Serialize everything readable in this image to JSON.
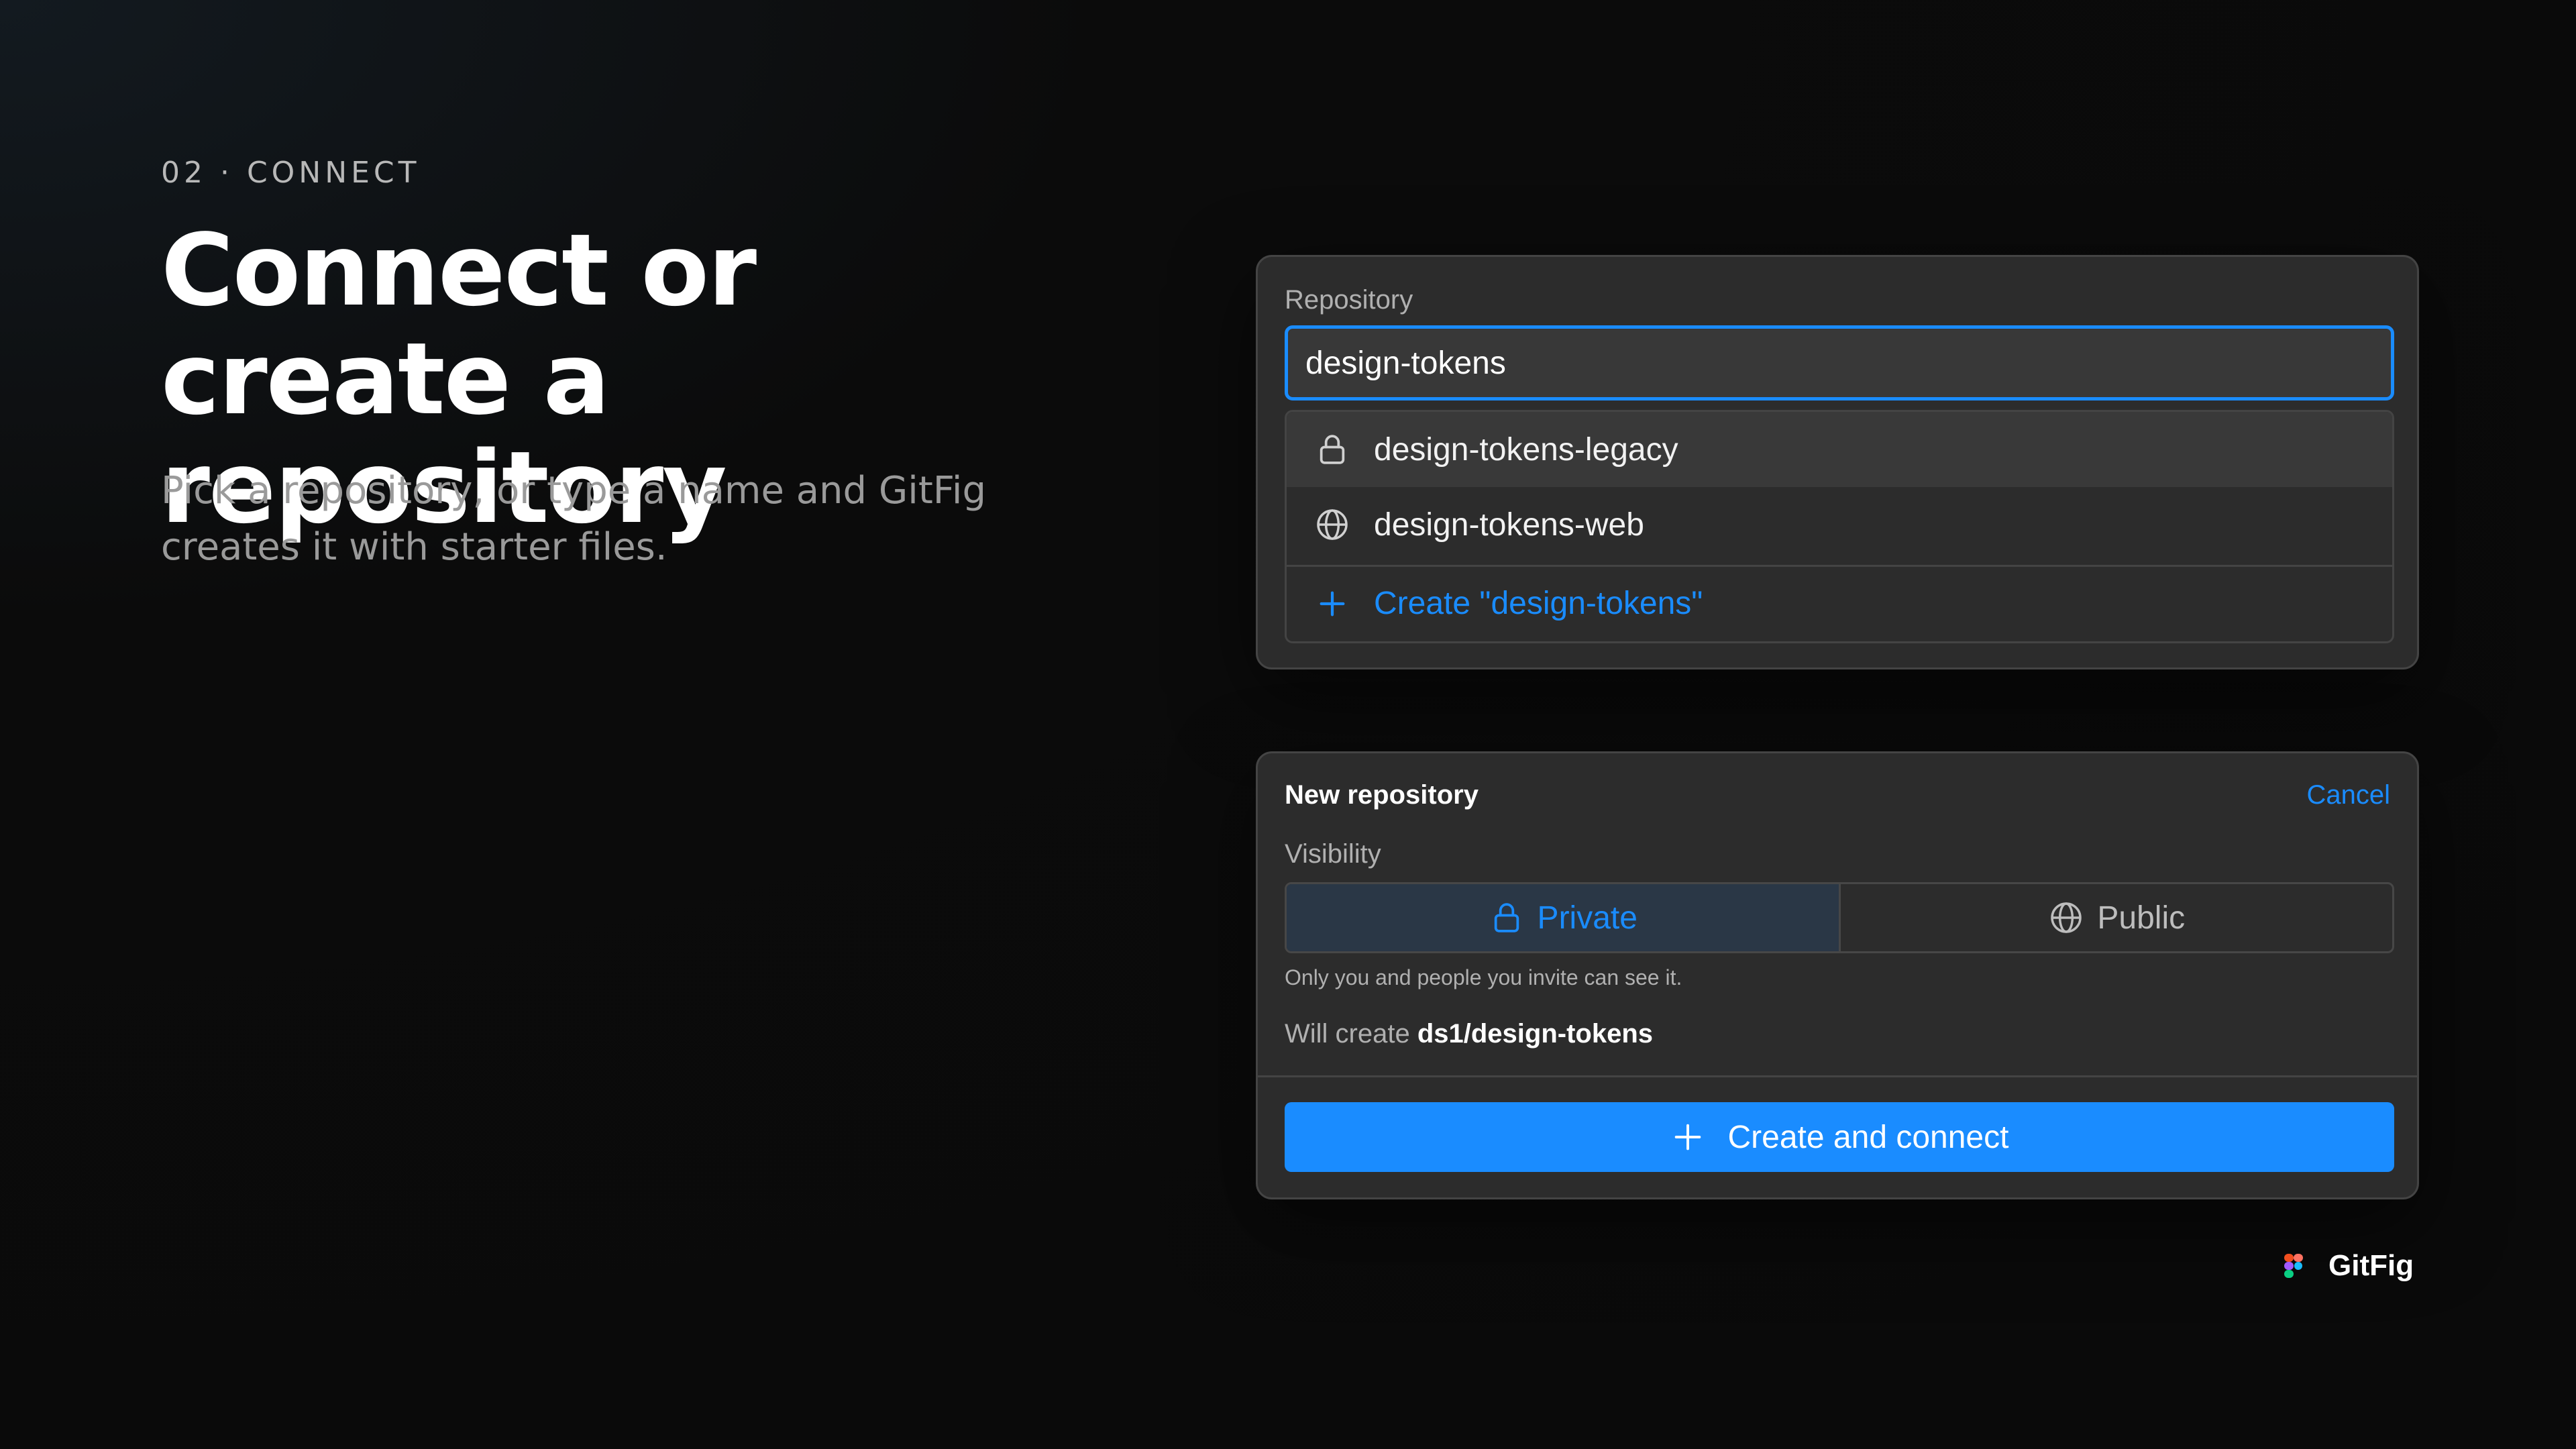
{
  "intro": {
    "eyebrow": "02 · CONNECT",
    "title": "Connect or create a repository",
    "subtitle": "Pick a repository, or type a name and GitFig creates it with starter files."
  },
  "repo_picker": {
    "label": "Repository",
    "input_value": "design-tokens",
    "options": [
      {
        "label": "design-tokens-legacy",
        "icon": "lock-icon",
        "highlighted": true
      },
      {
        "label": "design-tokens-web",
        "icon": "globe-icon",
        "highlighted": false
      }
    ],
    "create_option": "Create \"design-tokens\""
  },
  "new_repo": {
    "title": "New repository",
    "cancel": "Cancel",
    "visibility_label": "Visibility",
    "visibility_options": [
      {
        "label": "Private",
        "icon": "lock-icon",
        "selected": true
      },
      {
        "label": "Public",
        "icon": "globe-icon",
        "selected": false
      }
    ],
    "hint": "Only you and people you invite can see it.",
    "will_create_prefix": "Will create",
    "will_create_name": "ds1/design-tokens",
    "cta": "Create and connect"
  },
  "brand": {
    "name": "GitFig"
  },
  "colors": {
    "accent": "#1a8cff",
    "panel_bg": "#2c2c2c",
    "page_bg": "#0a0a0a",
    "selected_segment_bg": "#2a3746"
  }
}
